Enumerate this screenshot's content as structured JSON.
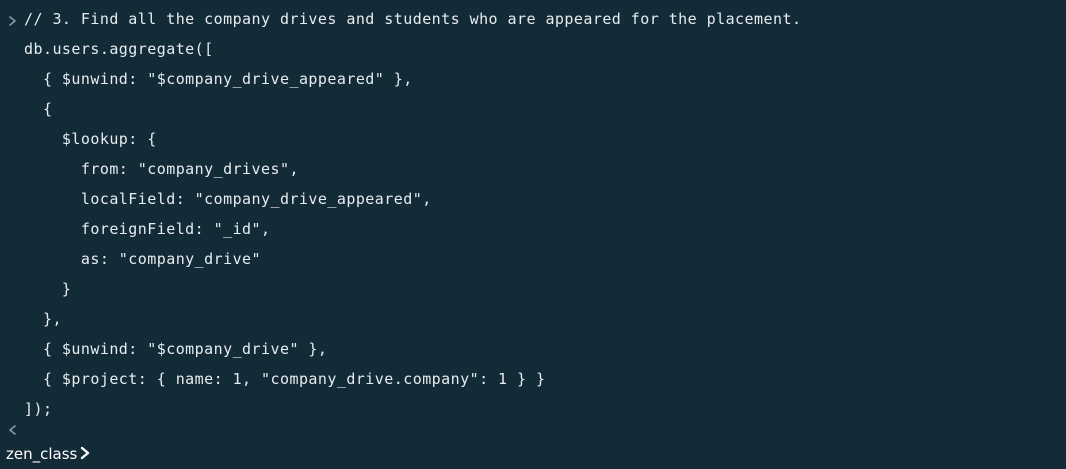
{
  "colors": {
    "background": "#132a37",
    "code_text": "#e6ecef",
    "chevron": "#8a9aa4",
    "prompt_text": "#ffffff"
  },
  "input": {
    "chevron_icon": "chevron-right-icon",
    "lines": [
      "// 3. Find all the company drives and students who are appeared for the placement.",
      "db.users.aggregate([",
      "  { $unwind: \"$company_drive_appeared\" },",
      "  {",
      "    $lookup: {",
      "      from: \"company_drives\",",
      "      localField: \"company_drive_appeared\",",
      "      foreignField: \"_id\",",
      "      as: \"company_drive\"",
      "    }",
      "  },",
      "  { $unwind: \"$company_drive\" },",
      "  { $project: { name: 1, \"company_drive.company\": 1 } }",
      "]);"
    ]
  },
  "output": {
    "chevron_icon": "chevron-left-icon"
  },
  "prompt": {
    "label": "zen_class",
    "caret_icon": "prompt-caret-icon"
  }
}
